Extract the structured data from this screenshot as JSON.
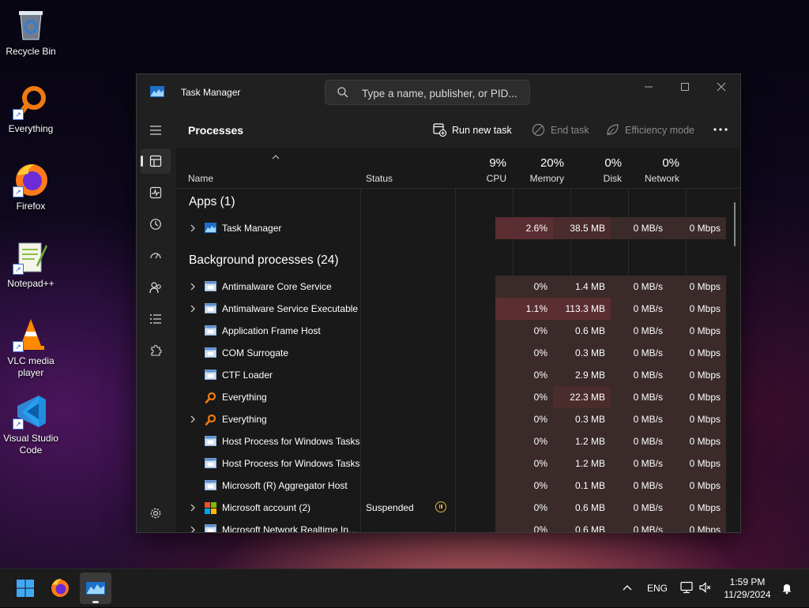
{
  "desktop": {
    "icons": [
      {
        "label": "Recycle Bin"
      },
      {
        "label": "Everything"
      },
      {
        "label": "Firefox"
      },
      {
        "label": "Notepad++"
      },
      {
        "label": "VLC media player"
      },
      {
        "label": "Visual Studio Code"
      }
    ]
  },
  "window": {
    "title": "Task Manager",
    "search_placeholder": "Type a name, publisher, or PID..."
  },
  "toolbar": {
    "page_title": "Processes",
    "run_new_task": "Run new task",
    "end_task": "End task",
    "efficiency_mode": "Efficiency mode"
  },
  "columns": {
    "name": "Name",
    "status": "Status",
    "cpu": {
      "pct": "9%",
      "label": "CPU"
    },
    "memory": {
      "pct": "20%",
      "label": "Memory"
    },
    "disk": {
      "pct": "0%",
      "label": "Disk"
    },
    "network": {
      "pct": "0%",
      "label": "Network"
    }
  },
  "groups": {
    "apps": "Apps (1)",
    "background": "Background processes (24)"
  },
  "apps": [
    {
      "name": "Task Manager",
      "status": "",
      "cpu": "2.6%",
      "memory": "38.5 MB",
      "disk": "0 MB/s",
      "network": "0 Mbps",
      "expandable": true,
      "icon": "task-manager-icon"
    }
  ],
  "background": [
    {
      "name": "Antimalware Core Service",
      "status": "",
      "cpu": "0%",
      "memory": "1.4 MB",
      "disk": "0 MB/s",
      "network": "0 Mbps",
      "expandable": true,
      "icon": "window-icon"
    },
    {
      "name": "Antimalware Service Executable",
      "status": "",
      "cpu": "1.1%",
      "memory": "113.3 MB",
      "disk": "0 MB/s",
      "network": "0 Mbps",
      "expandable": true,
      "icon": "window-icon"
    },
    {
      "name": "Application Frame Host",
      "status": "",
      "cpu": "0%",
      "memory": "0.6 MB",
      "disk": "0 MB/s",
      "network": "0 Mbps",
      "expandable": false,
      "icon": "window-icon"
    },
    {
      "name": "COM Surrogate",
      "status": "",
      "cpu": "0%",
      "memory": "0.3 MB",
      "disk": "0 MB/s",
      "network": "0 Mbps",
      "expandable": false,
      "icon": "window-icon"
    },
    {
      "name": "CTF Loader",
      "status": "",
      "cpu": "0%",
      "memory": "2.9 MB",
      "disk": "0 MB/s",
      "network": "0 Mbps",
      "expandable": false,
      "icon": "window-icon"
    },
    {
      "name": "Everything",
      "status": "",
      "cpu": "0%",
      "memory": "22.3 MB",
      "disk": "0 MB/s",
      "network": "0 Mbps",
      "expandable": false,
      "icon": "everything-icon"
    },
    {
      "name": "Everything",
      "status": "",
      "cpu": "0%",
      "memory": "0.3 MB",
      "disk": "0 MB/s",
      "network": "0 Mbps",
      "expandable": true,
      "icon": "everything-icon"
    },
    {
      "name": "Host Process for Windows Tasks",
      "status": "",
      "cpu": "0%",
      "memory": "1.2 MB",
      "disk": "0 MB/s",
      "network": "0 Mbps",
      "expandable": false,
      "icon": "window-icon"
    },
    {
      "name": "Host Process for Windows Tasks",
      "status": "",
      "cpu": "0%",
      "memory": "1.2 MB",
      "disk": "0 MB/s",
      "network": "0 Mbps",
      "expandable": false,
      "icon": "window-icon"
    },
    {
      "name": "Microsoft (R) Aggregator Host",
      "status": "",
      "cpu": "0%",
      "memory": "0.1 MB",
      "disk": "0 MB/s",
      "network": "0 Mbps",
      "expandable": false,
      "icon": "window-icon"
    },
    {
      "name": "Microsoft account (2)",
      "status": "Suspended",
      "cpu": "0%",
      "memory": "0.6 MB",
      "disk": "0 MB/s",
      "network": "0 Mbps",
      "expandable": true,
      "icon": "microsoft-logo-icon"
    },
    {
      "name": "Microsoft Network Realtime Inspection Service",
      "status": "",
      "cpu": "0%",
      "memory": "0.6 MB",
      "disk": "0 MB/s",
      "network": "0 Mbps",
      "expandable": true,
      "icon": "window-icon"
    }
  ],
  "taskbar": {
    "language": "ENG",
    "time": "1:59 PM",
    "date": "11/29/2024"
  },
  "colors": {
    "heat_low": "#3a2a2a",
    "heat_mid": "#4a2c2c",
    "heat_high": "#5a2e32",
    "accent_suspend": "#e0b43a"
  }
}
